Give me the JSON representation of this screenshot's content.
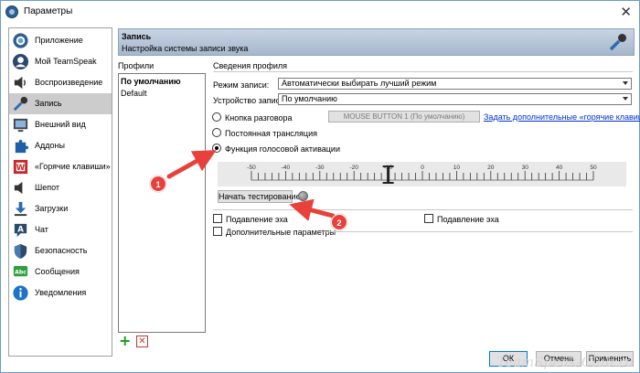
{
  "window": {
    "title": "Параметры",
    "close_glyph": "✕"
  },
  "sidebar": {
    "items": [
      {
        "label": "Приложение",
        "icon": "app-icon"
      },
      {
        "label": "Мой TeamSpeak",
        "icon": "user-icon"
      },
      {
        "label": "Воспроизведение",
        "icon": "speaker-icon"
      },
      {
        "label": "Запись",
        "icon": "mic-icon",
        "selected": true
      },
      {
        "label": "Внешний вид",
        "icon": "appearance-icon"
      },
      {
        "label": "Аддоны",
        "icon": "puzzle-icon"
      },
      {
        "label": "«Горячие клавиши»",
        "icon": "hotkeys-icon"
      },
      {
        "label": "Шепот",
        "icon": "whisper-icon"
      },
      {
        "label": "Загрузки",
        "icon": "download-icon"
      },
      {
        "label": "Чат",
        "icon": "chat-icon"
      },
      {
        "label": "Безопасность",
        "icon": "shield-icon"
      },
      {
        "label": "Сообщения",
        "icon": "messages-icon"
      },
      {
        "label": "Уведомления",
        "icon": "info-icon"
      }
    ]
  },
  "header": {
    "title": "Запись",
    "subtitle": "Настройка системы записи звука",
    "icon": "mic-icon"
  },
  "profiles": {
    "label": "Профили",
    "items": [
      "По умолчанию",
      "Default"
    ],
    "add_glyph": "+",
    "delete_glyph": "✕"
  },
  "profile_info": {
    "section_label": "Сведения профиля",
    "mode_label": "Режим записи:",
    "mode_value": "Автоматически выбирать лучший режим",
    "device_label": "Устройство записи:",
    "device_value": "По умолчанию",
    "ptt_label": "Кнопка разговора",
    "hotkey_button": "MOUSE BUTTON 1 (По умолчанию)",
    "hotkey_link": "Задать дополнительные «горячие клавиши»",
    "continuous_label": "Постоянная трансляция",
    "vad_label": "Функция голосовой активации",
    "selected_mode": "vad",
    "scale_ticks": [
      "-50",
      "-40",
      "-30",
      "-20",
      "-10",
      "0",
      "10",
      "20",
      "30",
      "40",
      "50"
    ],
    "threshold_db": -10,
    "test_button": "Начать тестирование",
    "echo_label_1": "Подавление эха",
    "echo_label_2": "Подавление эха",
    "advanced_label": "Дополнительные параметры"
  },
  "annotations": [
    "1",
    "2"
  ],
  "footer": {
    "ok": "ОК",
    "cancel": "Отмена",
    "apply": "Применить"
  },
  "watermark": "TeamSpeak-Club.ru",
  "colors": {
    "link": "#0033cc",
    "annotation": "#e8413c",
    "selection": "#cccccc",
    "header": "#b5c5d8"
  }
}
